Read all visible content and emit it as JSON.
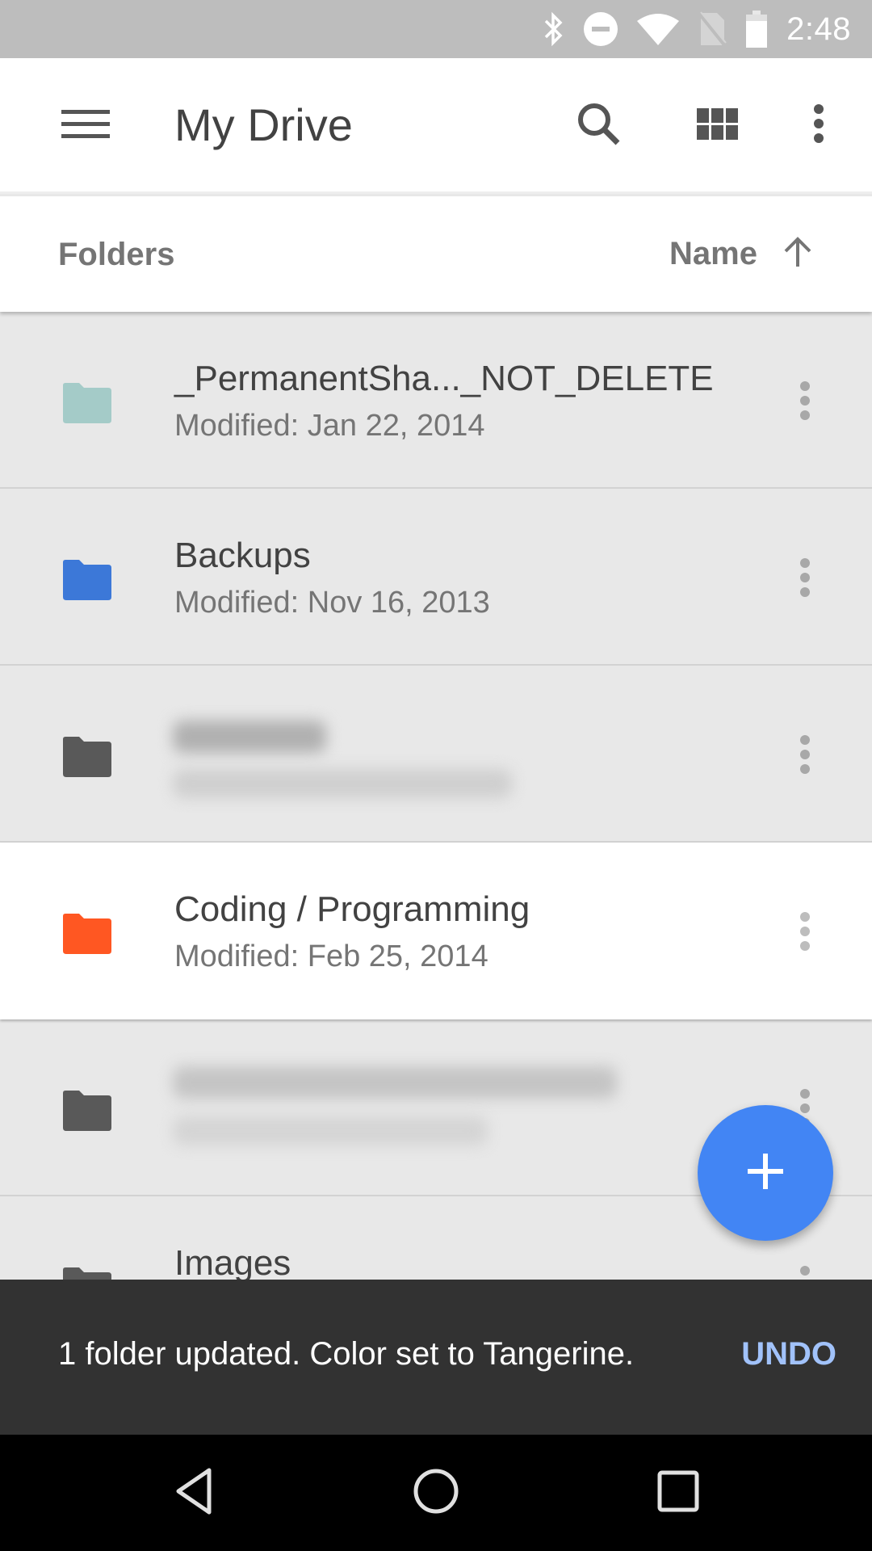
{
  "status_bar": {
    "time": "2:48",
    "icons": [
      "bluetooth-icon",
      "do-not-disturb-icon",
      "wifi-icon",
      "no-sim-icon",
      "battery-icon"
    ]
  },
  "app_bar": {
    "title": "My Drive",
    "menu_icon": "hamburger-menu-icon",
    "actions": [
      "search-icon",
      "grid-view-icon",
      "more-vert-icon"
    ]
  },
  "sort_header": {
    "section_label": "Folders",
    "sort_label": "Name",
    "sort_direction": "ascending"
  },
  "folders": [
    {
      "name": "_PermanentSha..._NOT_DELETE",
      "modified": "Modified: Jan 22, 2014",
      "color": "#a4cbc8",
      "blurred": false,
      "selected": false
    },
    {
      "name": "Backups",
      "modified": "Modified: Nov 16, 2013",
      "color": "#3c78d8",
      "blurred": false,
      "selected": false
    },
    {
      "name": "",
      "modified": "",
      "color": "#595959",
      "blurred": true,
      "selected": false
    },
    {
      "name": "Coding / Programming",
      "modified": "Modified: Feb 25, 2014",
      "color": "#ff5722",
      "blurred": false,
      "selected": true
    },
    {
      "name": "",
      "modified": "",
      "color": "#595959",
      "blurred": true,
      "selected": false
    },
    {
      "name": "Images",
      "modified": "",
      "color": "#595959",
      "blurred": false,
      "selected": false
    }
  ],
  "fab": {
    "icon": "plus-icon",
    "color": "#4285f4"
  },
  "snackbar": {
    "message": "1 folder updated. Color set to Tangerine.",
    "action": "UNDO"
  },
  "nav_bar": {
    "buttons": [
      "back-icon",
      "home-icon",
      "recents-icon"
    ]
  }
}
